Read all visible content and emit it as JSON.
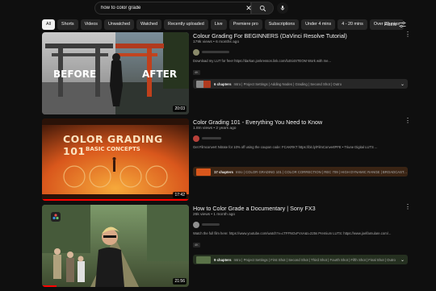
{
  "search": {
    "value": "how to color grade"
  },
  "chips": [
    "All",
    "Shorts",
    "Videos",
    "Unwatched",
    "Watched",
    "Recently uploaded",
    "Live",
    "Premiere pro",
    "Subscriptions",
    "Under 4 mins",
    "4 - 20 mins",
    "Over 20 mins"
  ],
  "filters_label": "Filters",
  "results": [
    {
      "title": "Colour Grading For BEGINNERS (DaVinci Resolve Tutorial)",
      "meta": "179k views • 6 months ago",
      "description": "Download my LUT for free! https://darkan.jonkresson.link.com/lutSi4STEOM Work with me...",
      "badge": "4K",
      "chapters_count": "6 chapters",
      "chapters_text": "Intro | Project Settings | Adding Nodes | Grading | Second Shot | Outro",
      "duration": "20:03",
      "thumb_before": "BEFORE",
      "thumb_after": "AFTER",
      "progress": 0
    },
    {
      "title": "Color Grading 101 - Everything You Need to Know",
      "meta": "1.8m views • 2 years ago",
      "description": "Get Filmconvert Nitrate for 10% off using the coupon code: FCAKRKT https://bit.ly/FilmConvertPFE • Triune Digital LUTS ...",
      "badge": "",
      "chapters_count": "17 chapters",
      "chapters_text": "Intro | COLOR GRADING 101 | COLOR CORRECTION | REC 709 | HIGH DYNAMIC RANGE | BROADCAST...",
      "duration": "17:42",
      "thumb_line1": "COLOR GRADING 101",
      "thumb_line2": "BASIC CONCEPTS",
      "progress": 1.0
    },
    {
      "title": "How to Color Grade a Documentary | Sony FX3",
      "meta": "26k views • 1 month ago",
      "description": "Watch the full film here: https://www.youtube.com/watch?v=cTFFNGvFVxA&t=225s Premium LUTS: https://www.joelfamulare.com/...",
      "badge": "4K",
      "chapters_count": "9 chapters",
      "chapters_text": "Intro | Project Settings | First Shot | Second Shot | Third Shot | Fourth Shot | Fifth Shot | Final Shot | Outro",
      "duration": "21:56",
      "progress": 0.1
    }
  ],
  "icons": {
    "clear": "close-icon",
    "search": "search-icon",
    "mic": "mic-icon",
    "filters": "filters-icon",
    "more": "more-vert-icon",
    "expand": "chevron-down-icon"
  },
  "colors": {
    "background": "#0f0f0f",
    "chip": "#272727",
    "chip_active": "#f1f1f1",
    "progress": "#ff0000"
  }
}
